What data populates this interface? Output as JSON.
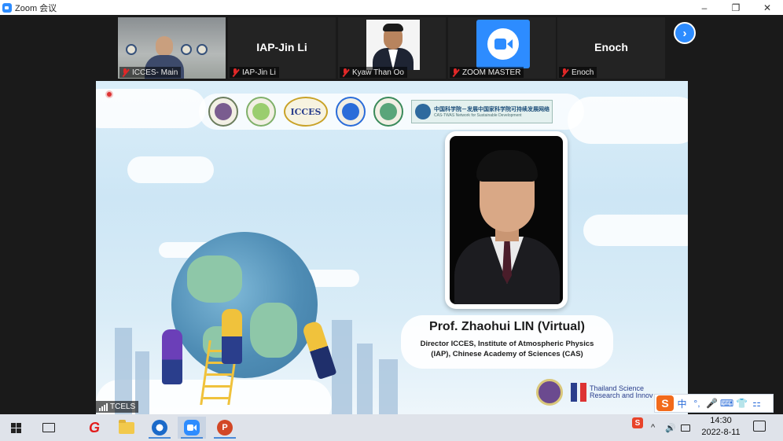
{
  "window": {
    "title": "Zoom 会议",
    "controls": [
      "–",
      "❐",
      "✕"
    ]
  },
  "participants": [
    {
      "name": "ICCES- Main",
      "muted": true,
      "video": "photo"
    },
    {
      "name": "IAP-Jin Li",
      "display_name": "IAP-Jin Li",
      "muted": true,
      "video": "off"
    },
    {
      "name": "Kyaw Than Oo",
      "muted": true,
      "video": "photo"
    },
    {
      "name": "ZOOM MASTER",
      "muted": true,
      "video": "zoom-logo"
    },
    {
      "name": "Enoch",
      "display_name": "Enoch",
      "muted": true,
      "video": "off"
    }
  ],
  "next_button": "›",
  "slide": {
    "logo_icces": "ICCES",
    "logo_anso_line1": "中国科学院－发展中国家科学院可持续发展网络",
    "logo_anso_line2": "CAS-TWAS Network for Sustainable Development",
    "speaker_name": "Prof. Zhaohui LIN (Virtual)",
    "speaker_title_line1": "Director ICCES, Institute of Atmospheric Physics",
    "speaker_title_line2": "(IAP), Chinese Academy of Sciences (CAS)",
    "sponsor_line1": "Thailand Science",
    "sponsor_line2": "Research and Innov"
  },
  "shared_by": "TCELS",
  "ime": {
    "logo": "S",
    "items": [
      "中",
      "°,",
      "🎤",
      "⌨",
      "👕",
      "⚏"
    ]
  },
  "tray": {
    "chevron": "^",
    "volume": "🔊",
    "s_icon": "S"
  },
  "clock": {
    "time": "14:30",
    "date": "2022-8-11"
  },
  "colors": {
    "zoom_blue": "#2d8cff",
    "muted_red": "#e02828",
    "ime_orange": "#f26a1b"
  }
}
